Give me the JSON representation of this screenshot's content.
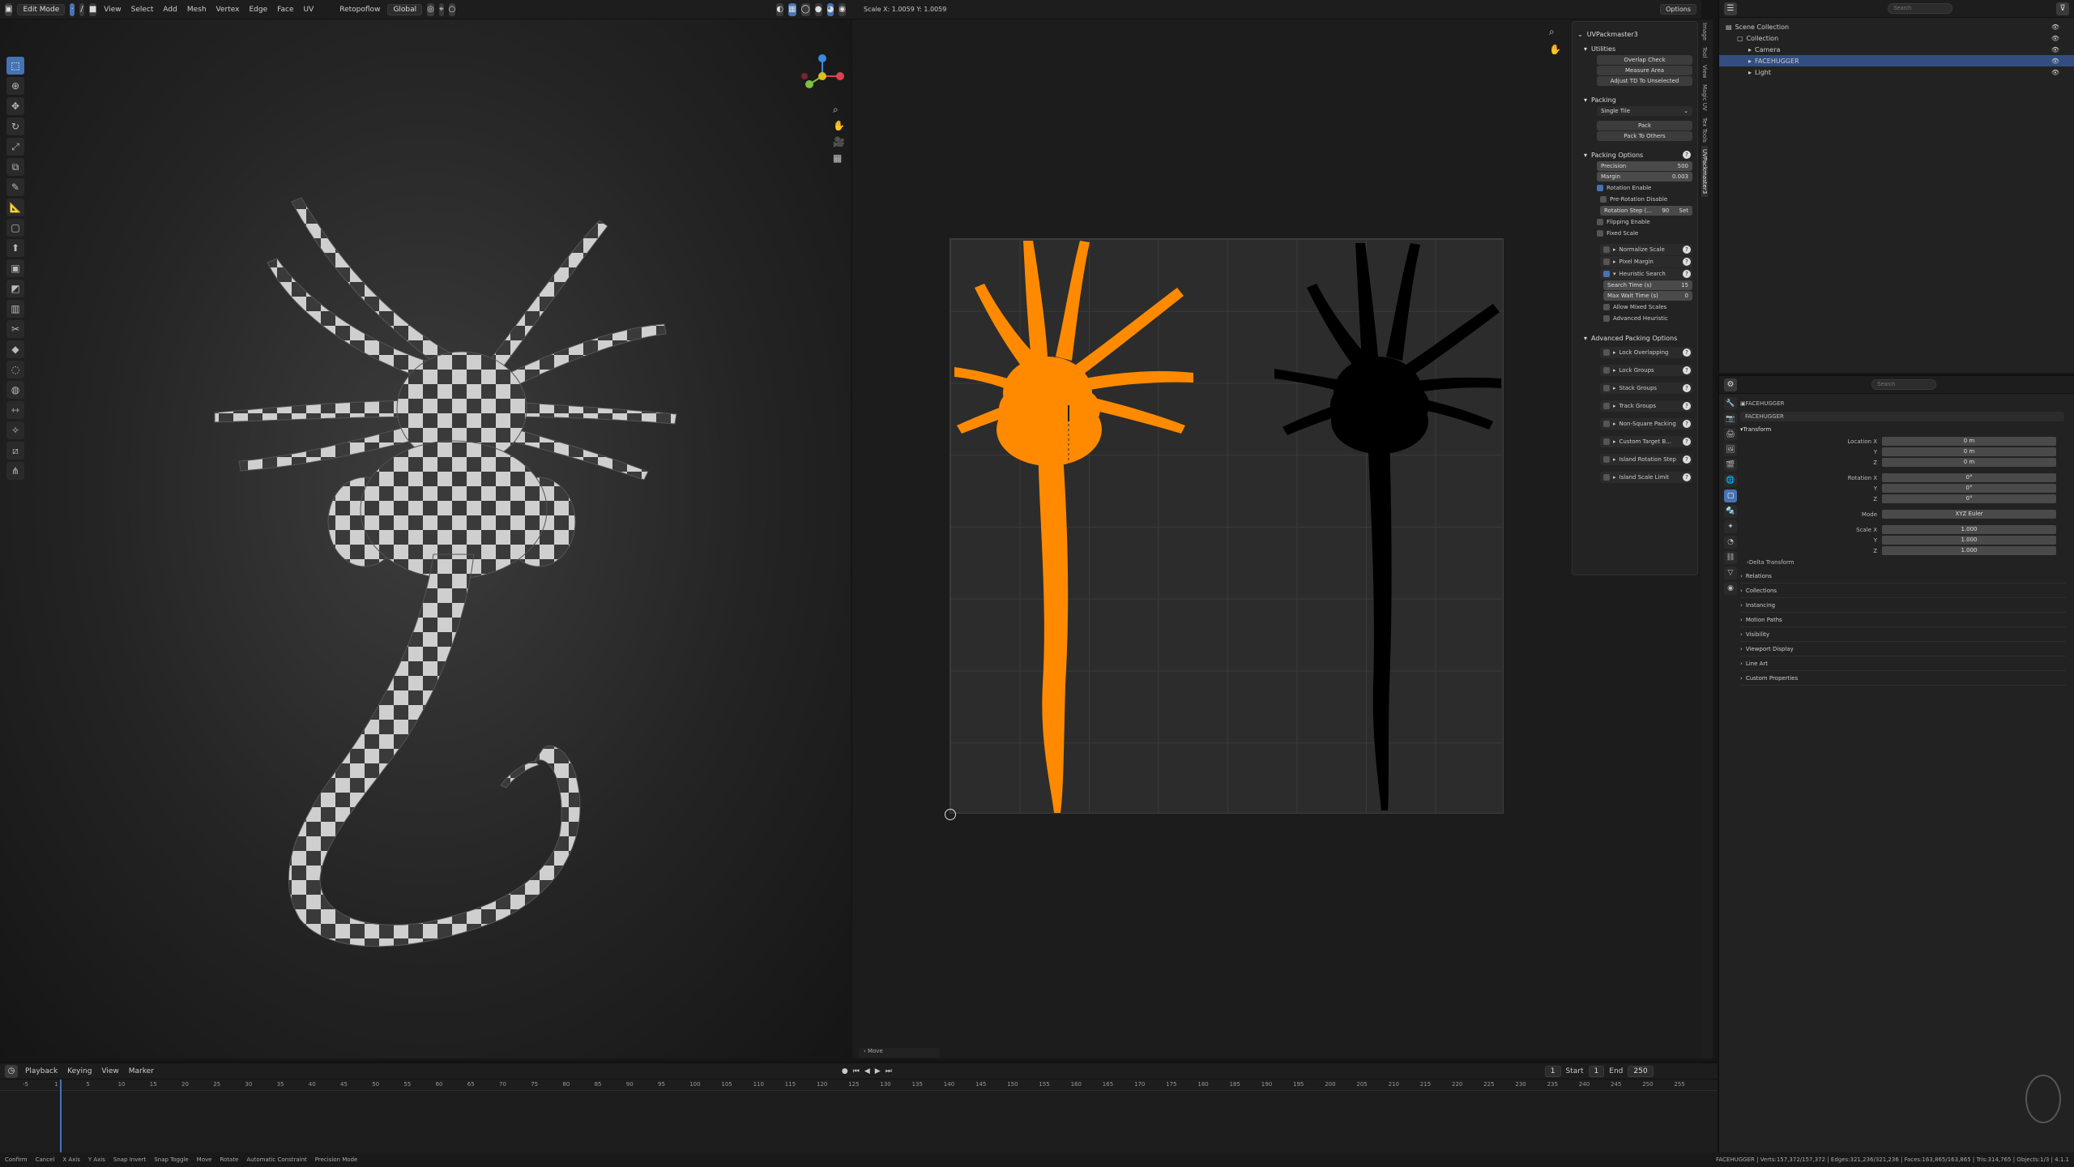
{
  "header3d": {
    "mode": "Edit Mode",
    "menus": [
      "View",
      "Select",
      "Add",
      "Mesh",
      "Vertex",
      "Edge",
      "Face",
      "UV"
    ],
    "retopoflow": "Retopoflow",
    "transform_orientation": "Global",
    "options": "Options"
  },
  "uv_header": {
    "scale_readout": "Scale X: 1.0059   Y: 1.0059"
  },
  "npanel": {
    "title": "UVPackmaster3",
    "utilities": {
      "label": "Utilities",
      "buttons": [
        "Overlap Check",
        "Measure Area",
        "Adjust TD To Unselected"
      ]
    },
    "packing": {
      "label": "Packing",
      "mode": "Single Tile",
      "buttons": [
        "Pack",
        "Pack To Others"
      ]
    },
    "packing_options": {
      "label": "Packing Options",
      "precision_label": "Precision",
      "precision_value": "500",
      "margin_label": "Margin",
      "margin_value": "0.003",
      "rotation_enable": "Rotation Enable",
      "pre_rotation_disable": "Pre-Rotation Disable",
      "rotation_step_label": "Rotation Step (...",
      "rotation_step_value": "90",
      "rotation_step_set": "Set",
      "flipping_enable": "Flipping Enable",
      "fixed_scale": "Fixed Scale"
    },
    "subpanels": [
      "Normalize Scale",
      "Pixel Margin",
      "Heuristic Search"
    ],
    "heuristic": {
      "search_time_label": "Search Time (s)",
      "search_time_value": "15",
      "max_wait_label": "Max Wait Time (s)",
      "max_wait_value": "0",
      "allow_mixed": "Allow Mixed Scales",
      "advanced": "Advanced Heuristic"
    },
    "advanced": {
      "label": "Advanced Packing Options",
      "items": [
        "Lock Overlapping",
        "Lock Groups",
        "Stack Groups",
        "Track Groups",
        "Non-Square Packing",
        "Custom Target B...",
        "Island Rotation Step",
        "Island Scale Limit"
      ]
    }
  },
  "vtabs": [
    "Image",
    "Tool",
    "View",
    "Magic UV",
    "Tex Tools",
    "UVPackmaster3"
  ],
  "outliner": {
    "search_placeholder": "Search",
    "rows": [
      {
        "label": "Scene Collection",
        "indent": 0,
        "selected": false
      },
      {
        "label": "Collection",
        "indent": 1,
        "selected": false
      },
      {
        "label": "Camera",
        "indent": 2,
        "selected": false
      },
      {
        "label": "FACEHUGGER",
        "indent": 2,
        "selected": true
      },
      {
        "label": "Light",
        "indent": 2,
        "selected": false
      }
    ]
  },
  "properties": {
    "search_placeholder": "Search",
    "object_name": "FACEHUGGER",
    "object_field": "FACEHUGGER",
    "transform_label": "Transform",
    "rows": [
      {
        "label": "Location X",
        "value": "0 m"
      },
      {
        "label": "Y",
        "value": "0 m"
      },
      {
        "label": "Z",
        "value": "0 m"
      },
      {
        "label": "Rotation X",
        "value": "0°"
      },
      {
        "label": "Y",
        "value": "0°"
      },
      {
        "label": "Z",
        "value": "0°"
      },
      {
        "label": "Mode",
        "value": "XYZ Euler"
      },
      {
        "label": "Scale X",
        "value": "1.000"
      },
      {
        "label": "Y",
        "value": "1.000"
      },
      {
        "label": "Z",
        "value": "1.000"
      }
    ],
    "delta": "Delta Transform",
    "sections": [
      "Relations",
      "Collections",
      "Instancing",
      "Motion Paths",
      "Visibility",
      "Viewport Display",
      "Line Art",
      "Custom Properties"
    ]
  },
  "timeline": {
    "menus": [
      "Playback",
      "Keying",
      "View",
      "Marker"
    ],
    "current_frame": "1",
    "start_label": "Start",
    "start_value": "1",
    "end_label": "End",
    "end_value": "250",
    "ticks": [
      "-5",
      "1",
      "5",
      "10",
      "15",
      "20",
      "25",
      "30",
      "35",
      "40",
      "45",
      "50",
      "55",
      "60",
      "65",
      "70",
      "75",
      "80",
      "85",
      "90",
      "95",
      "100",
      "105",
      "110",
      "115",
      "120",
      "125",
      "130",
      "135",
      "140",
      "145",
      "150",
      "155",
      "160",
      "165",
      "170",
      "175",
      "180",
      "185",
      "190",
      "195",
      "200",
      "205",
      "210",
      "215",
      "220",
      "225",
      "230",
      "235",
      "240",
      "245",
      "250",
      "255"
    ]
  },
  "last_op": "Move",
  "statusbar": {
    "items": [
      "Confirm",
      "Cancel",
      "X Axis",
      "Y Axis",
      "Snap Invert",
      "Snap Toggle",
      "Move",
      "Rotate",
      "Automatic Constraint",
      "Precision Mode"
    ],
    "right": "FACEHUGGER | Verts:157,372/157,372 | Edges:321,236/321,236 | Faces:163,865/163,865 | Tris:314,765 | Objects:1/3 | 4.1.1"
  },
  "colors": {
    "accent": "#4772b3",
    "island_orange": "#ff8a00",
    "island_black": "#000000"
  }
}
